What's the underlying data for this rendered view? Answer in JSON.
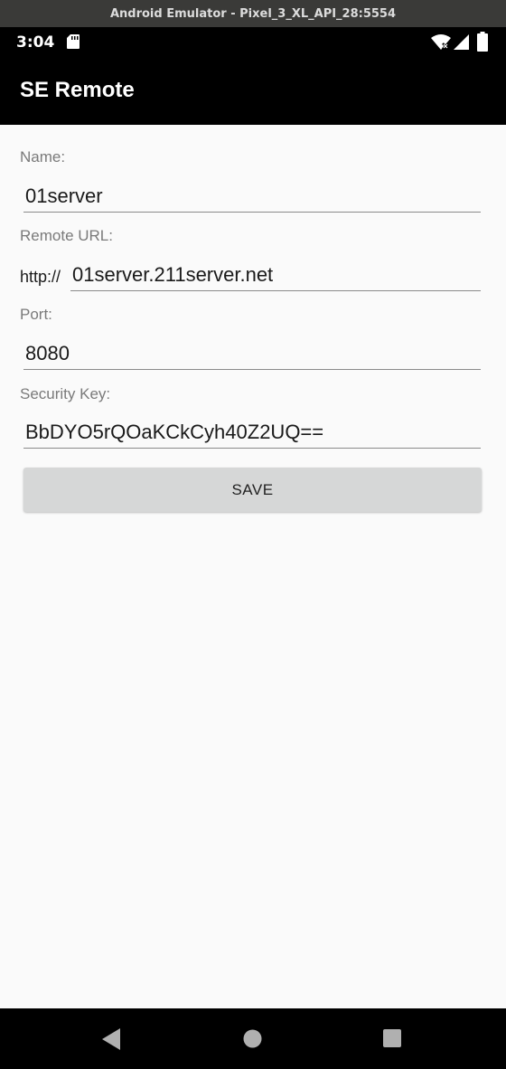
{
  "window": {
    "title": "Android Emulator - Pixel_3_XL_API_28:5554"
  },
  "status_bar": {
    "time": "3:04"
  },
  "app_bar": {
    "title": "SE Remote"
  },
  "form": {
    "name_label": "Name:",
    "name_value": "01server",
    "url_label": "Remote URL:",
    "url_prefix": "http://",
    "url_value": "01server.211server.net",
    "port_label": "Port:",
    "port_value": "8080",
    "key_label": "Security Key:",
    "key_value": "BbDYO5rQOaKCkCyh40Z2UQ=="
  },
  "actions": {
    "save_label": "SAVE"
  },
  "icons": {
    "sd": "sd-card-icon",
    "wifi": "wifi-icon",
    "signal": "cell-signal-icon",
    "battery": "battery-icon",
    "back": "back-icon",
    "home": "home-icon",
    "recents": "recents-icon"
  },
  "colors": {
    "app_bar_bg": "#000000",
    "content_bg": "#fafafa",
    "button_bg": "#d6d7d7",
    "label_text": "#7a7a7a"
  }
}
